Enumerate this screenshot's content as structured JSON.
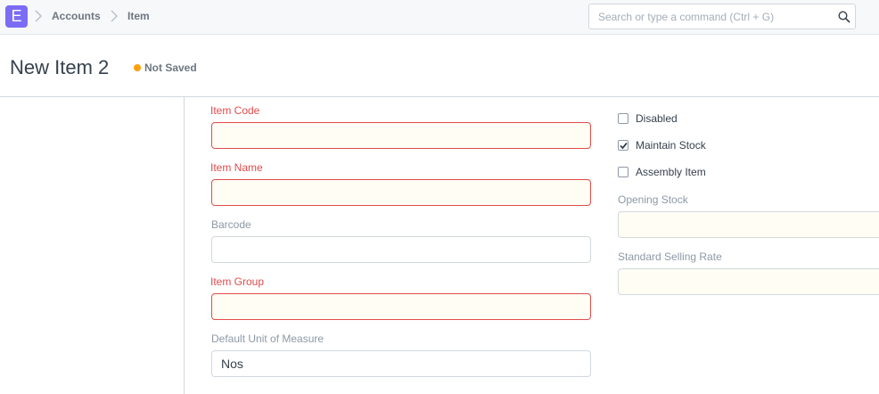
{
  "navbar": {
    "logo_letter": "E",
    "breadcrumbs": [
      "Accounts",
      "Item"
    ],
    "search_placeholder": "Search or type a command (Ctrl + G)"
  },
  "page": {
    "title": "New Item 2",
    "status": "Not Saved",
    "status_color": "#ffa00a"
  },
  "form": {
    "left": [
      {
        "label": "Item Code",
        "value": "",
        "required": true
      },
      {
        "label": "Item Name",
        "value": "",
        "required": true
      },
      {
        "label": "Barcode",
        "value": "",
        "required": false
      },
      {
        "label": "Item Group",
        "value": "",
        "required": true
      },
      {
        "label": "Default Unit of Measure",
        "value": "Nos",
        "required": false
      }
    ],
    "checks": [
      {
        "label": "Disabled",
        "checked": false
      },
      {
        "label": "Maintain Stock",
        "checked": true
      },
      {
        "label": "Assembly Item",
        "checked": false
      }
    ],
    "right": [
      {
        "label": "Opening Stock",
        "value": ""
      },
      {
        "label": "Standard Selling Rate",
        "value": ""
      }
    ]
  },
  "colors": {
    "accent": "#7b6cf5",
    "required": "#e24c4c"
  }
}
